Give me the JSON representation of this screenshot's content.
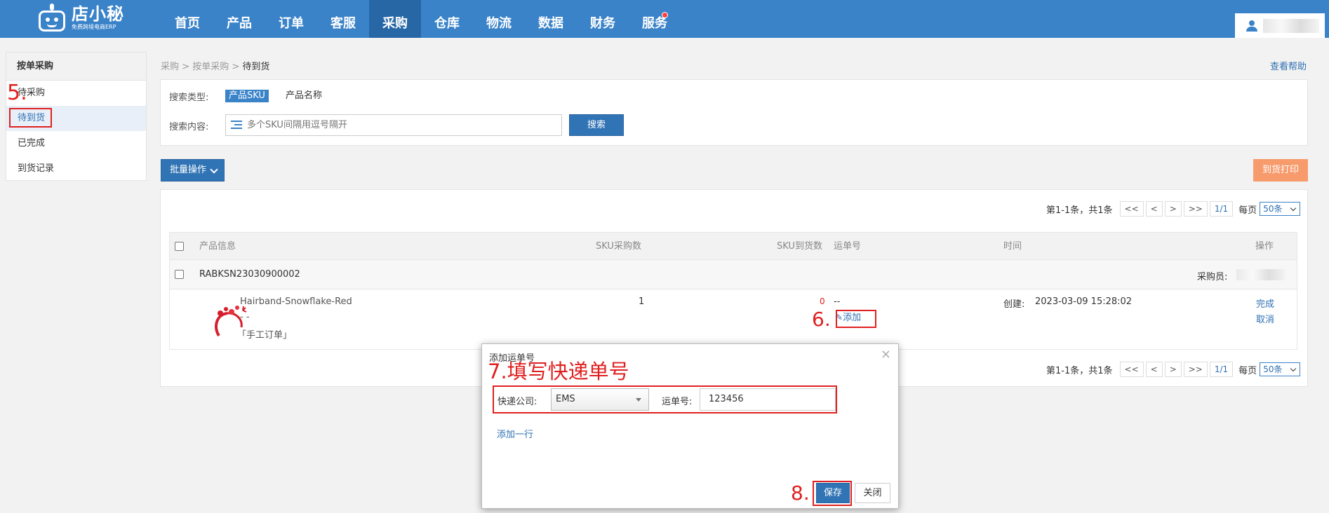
{
  "app": {
    "logo_name": "店小秘",
    "logo_sub": "免费跨境电商ERP"
  },
  "nav": {
    "items": [
      "首页",
      "产品",
      "订单",
      "客服",
      "采购",
      "仓库",
      "物流",
      "数据",
      "财务",
      "服务"
    ],
    "active_index": 4
  },
  "sidebar": {
    "title": "按单采购",
    "items": [
      "待采购",
      "待到货",
      "已完成",
      "到货记录"
    ],
    "active_index": 1
  },
  "breadcrumb": {
    "items": [
      "采购",
      "按单采购",
      "待到货"
    ],
    "sep": ">"
  },
  "help_link": "查看帮助",
  "search": {
    "type_label": "搜索类型:",
    "type_active": "产品SKU",
    "type_other": "产品名称",
    "content_label": "搜索内容:",
    "placeholder": "多个SKU间隔用逗号隔开",
    "button": "搜索"
  },
  "toolbar": {
    "batch": "批量操作",
    "print": "到货打印"
  },
  "pager": {
    "info": "第1-1条，共1条",
    "first": "<<",
    "prev": "<",
    "next": ">",
    "last": ">>",
    "current": "1/1",
    "per_page_label": "每页",
    "per_page_value": "50条"
  },
  "table": {
    "headers": [
      "产品信息",
      "SKU采购数",
      "SKU到货数",
      "运单号",
      "时间",
      "操作"
    ],
    "order_no": "RABKSN23030900002",
    "buyer_label": "采购员:",
    "product": {
      "name": "Hairband-Snowflake-Red",
      "variant": "- -",
      "tag": "「手工订单」",
      "qty_purchased": "1",
      "qty_arrived": "0",
      "tracking": "--",
      "add_link": "添加",
      "created_label": "创建:",
      "created_time": "2023-03-09 15:28:02",
      "action_complete": "完成",
      "action_cancel": "取消"
    }
  },
  "modal": {
    "title": "添加运单号",
    "close": "×",
    "carrier_label": "快递公司:",
    "carrier_value": "EMS",
    "tracking_label": "运单号:",
    "tracking_value": "123456",
    "add_row": "添加一行",
    "save": "保存",
    "cancel": "关闭"
  },
  "annotations": {
    "step5": "5.",
    "step6": "6.",
    "step7": "7.填写快递单号",
    "step8": "8."
  },
  "colors": {
    "nav_bg": "#3a83c9",
    "primary": "#3174b5",
    "link": "#2f70b3",
    "print_btn": "#f79b6c",
    "annotation_red": "#e02020"
  }
}
